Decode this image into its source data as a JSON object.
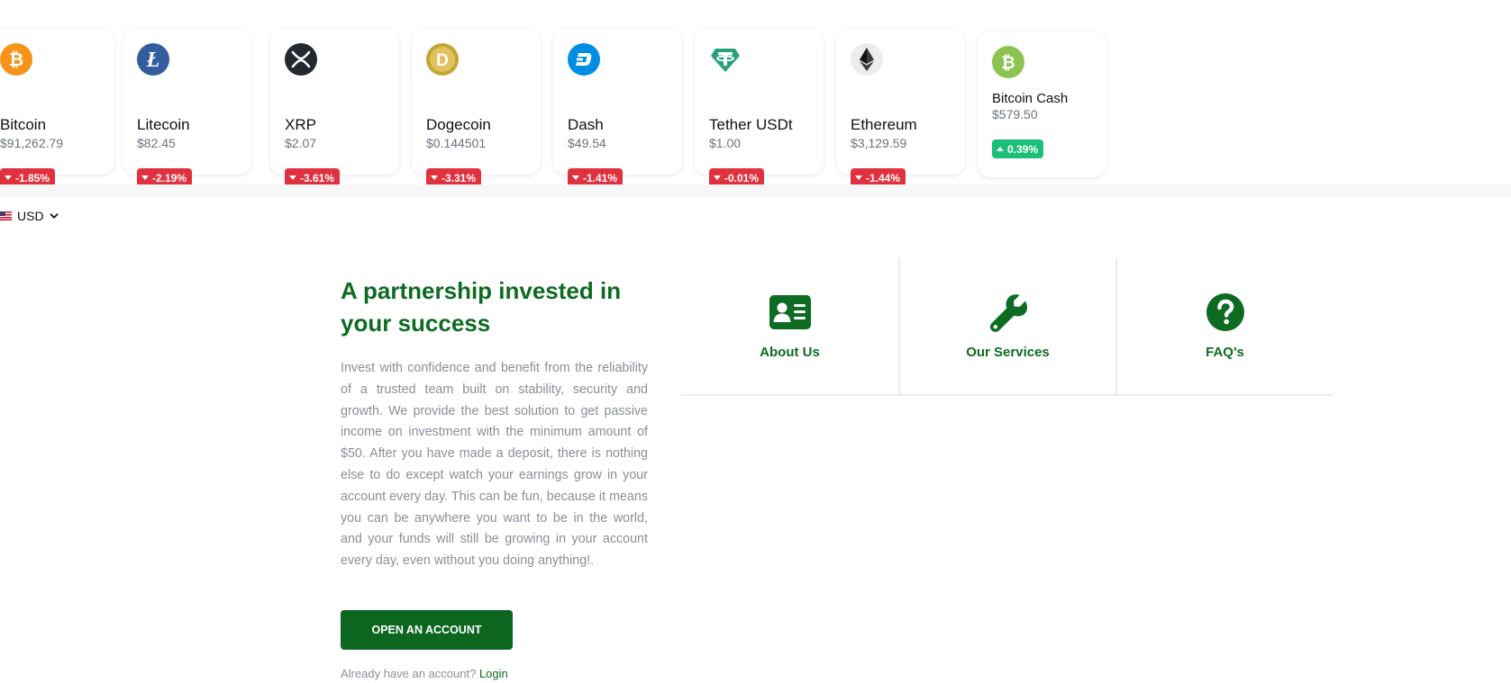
{
  "colors": {
    "brand_green": "#0d6b22",
    "button_green": "#0c6620",
    "negative_badge": "#e0313e",
    "positive_badge": "#1bbf7a",
    "muted_text": "#8a8f99"
  },
  "ticker": {
    "coins": [
      {
        "name": "Bitcoin",
        "price": "$91,262.79",
        "change": "-1.85%",
        "direction": "down",
        "icon": "bitcoin-icon"
      },
      {
        "name": "Litecoin",
        "price": "$82.45",
        "change": "-2.19%",
        "direction": "down",
        "icon": "litecoin-icon"
      },
      {
        "name": "XRP",
        "price": "$2.07",
        "change": "-3.61%",
        "direction": "down",
        "icon": "xrp-icon"
      },
      {
        "name": "Dogecoin",
        "price": "$0.144501",
        "change": "-3.31%",
        "direction": "down",
        "icon": "dogecoin-icon"
      },
      {
        "name": "Dash",
        "price": "$49.54",
        "change": "-1.41%",
        "direction": "down",
        "icon": "dash-icon"
      },
      {
        "name": "Tether USDt",
        "price": "$1.00",
        "change": "-0.01%",
        "direction": "down",
        "icon": "tether-icon"
      },
      {
        "name": "Ethereum",
        "price": "$3,129.59",
        "change": "-1.44%",
        "direction": "down",
        "icon": "ethereum-icon"
      },
      {
        "name": "Bitcoin Cash",
        "price": "$579.50",
        "change": "0.39%",
        "direction": "up",
        "icon": "bitcoin-cash-icon"
      }
    ]
  },
  "currency": {
    "label": "USD",
    "icon": "us-flag-icon"
  },
  "hero": {
    "title": "A partnership invested in your success",
    "body": "Invest with confidence and benefit from the reliability of a trusted team built on stability, security and growth. We provide the best solution to get passive income on investment with the minimum amount of $50. After you have made a deposit, there is nothing else to do except watch your earnings grow in your account every day. This can be fun, because it means you can be anywhere you want to be in the world, and your funds will still be growing in your account every day, even without you doing anything!.",
    "cta_label": "OPEN AN ACCOUNT",
    "login_prompt": "Already have an account?",
    "login_link": "Login"
  },
  "features": [
    {
      "label": "About Us",
      "icon": "id-card-icon"
    },
    {
      "label": "Our Services",
      "icon": "wrench-icon"
    },
    {
      "label": "FAQ's",
      "icon": "question-circle-icon"
    }
  ]
}
